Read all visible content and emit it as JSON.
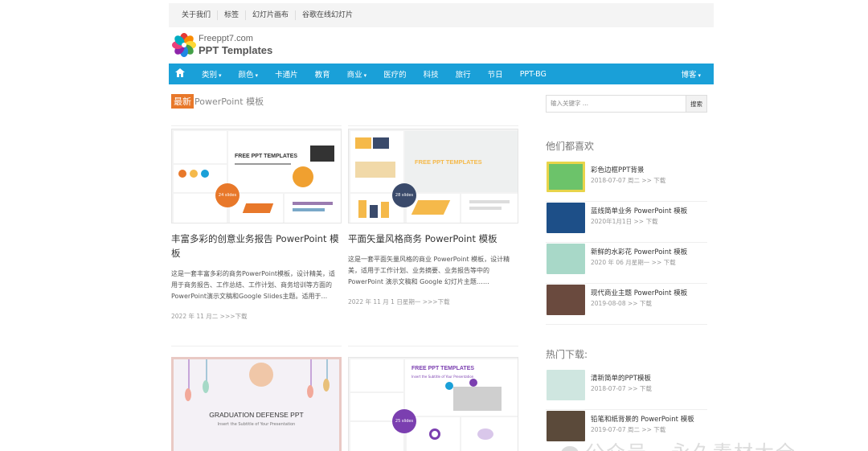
{
  "topbar": {
    "links": [
      "关于我们",
      "标签",
      "幻灯片画布",
      "谷歌在线幻灯片"
    ]
  },
  "logo": {
    "line1": "Freeppt7.com",
    "line2": "PPT Templates",
    "colors": [
      "#e53935",
      "#fb8c00",
      "#fdd835",
      "#43a047",
      "#1e88e5",
      "#8e24aa",
      "#ec407a",
      "#00acc1"
    ]
  },
  "nav": {
    "home_icon": "home-icon",
    "items": [
      {
        "label": "类别",
        "dropdown": true
      },
      {
        "label": "颜色",
        "dropdown": true
      },
      {
        "label": "卡通片",
        "dropdown": false
      },
      {
        "label": "教育",
        "dropdown": false
      },
      {
        "label": "商业",
        "dropdown": true
      },
      {
        "label": "医疗的",
        "dropdown": false
      },
      {
        "label": "科技",
        "dropdown": false
      },
      {
        "label": "旅行",
        "dropdown": false
      },
      {
        "label": "节日",
        "dropdown": false
      },
      {
        "label": "PPT-BG",
        "dropdown": false
      }
    ],
    "right": "博客",
    "color": "#1aa0d8"
  },
  "section": {
    "badge": "最新",
    "title": " PowerPoint 模板"
  },
  "search": {
    "placeholder": "输入关键字 ...",
    "button": "搜索"
  },
  "cards": [
    {
      "title": "丰富多彩的创意业务报告 PowerPoint 模板",
      "desc": "这是一套丰富多彩的商务PowerPoint模板，设计精美，适用于商务报告、工作总结、工作计划、商务培训等方面的PowerPoint演示文稿和Google Slides主题。适用于...",
      "meta": "2022 年 11 月二 >>>下载",
      "thumb_heading": "FREE PPT TEMPLATES",
      "slides_badge": "24 slides",
      "badge_color": "#e8782a"
    },
    {
      "title": "平面矢量风格商务 PowerPoint 模板",
      "desc": "这是一套平面矢量风格的商业 PowerPoint 模板，设计精美，适用于工作计划、业务摘要、业务报告等中的 PowerPoint 演示文稿和 Google 幻灯片主题……",
      "meta": "2022 年 11 月 1 日星期一 >>>下载",
      "thumb_heading": "FREE PPT TEMPLATES",
      "slides_badge": "28 slides",
      "badge_color": "#3a4a6b"
    },
    {
      "thumb_heading": "GRADUATION DEFENSE PPT",
      "thumb_sub": "Insert the Subtitle of Your Presentation"
    },
    {
      "thumb_heading": "FREE PPT TEMPLATES",
      "thumb_sub": "Insert the Subtitle of Your Presentation",
      "slides_badge": "25 slides",
      "badge_color": "#7b3fb0"
    }
  ],
  "sidebar": {
    "liked_heading": "他们都喜欢",
    "liked": [
      {
        "title": "彩色边框PPT背景",
        "meta": "2018-07-07 周二 >> 下载",
        "color": "#6cc36a"
      },
      {
        "title": "蓝线简单业务 PowerPoint 模板",
        "meta": "2020年1月1日 >> 下载",
        "color": "#1d4f88"
      },
      {
        "title": "新鲜的水彩花 PowerPoint 模板",
        "meta": "2020 年 06 月星期一 >> 下载",
        "color": "#a8d8c8"
      },
      {
        "title": "现代商业主题 PowerPoint 模板",
        "meta": "2019-08-08 >> 下载",
        "color": "#6a4a3e"
      }
    ],
    "hot_heading": "热门下载:",
    "hot": [
      {
        "title": "清新简单的PPT模板",
        "meta": "2018-07-07 >> 下载",
        "color": "#cfe6e0"
      },
      {
        "title": "铅笔和纸背景的 PowerPoint 模板",
        "meta": "2019-07-07 周二 >> 下载",
        "color": "#5b4a3a"
      }
    ]
  },
  "watermark": "公众号 · 永久素材大全"
}
